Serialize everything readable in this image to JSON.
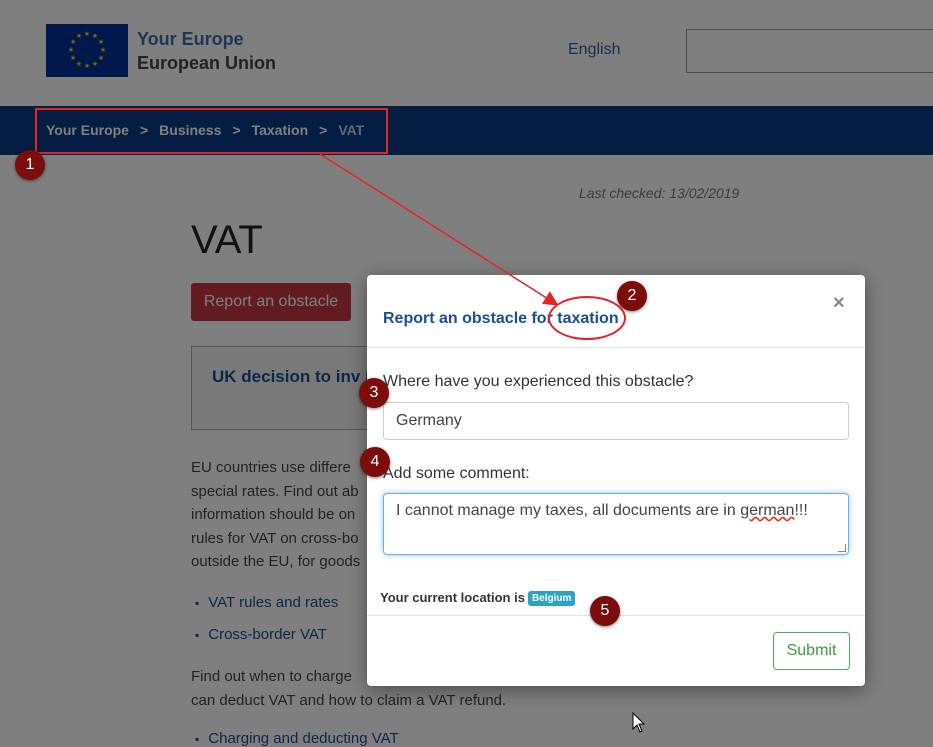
{
  "header": {
    "brand_title": "Your Europe",
    "brand_sub": "European Union",
    "language": "English",
    "search_value": ""
  },
  "breadcrumb": [
    "Your Europe",
    "Business",
    "Taxation",
    "VAT"
  ],
  "breadcrumb_separator": ">",
  "main": {
    "last_checked": "Last checked: 13/02/2019",
    "title": "VAT",
    "report_button": "Report an obstacle",
    "uk_box": "UK decision to inv information",
    "para1": [
      "EU countries use differe",
      "special rates. Find out ab",
      "information should be on",
      "rules for VAT on cross-bo",
      "outside the EU, for goods"
    ],
    "links1": [
      "VAT rules and rates",
      "Cross-border VAT"
    ],
    "para2": [
      "Find out when to charge",
      "can deduct VAT and how to claim a VAT refund."
    ],
    "links2": [
      "Charging and deducting VAT"
    ]
  },
  "modal": {
    "title_prefix": "Report an obstacle for ",
    "title_topic": "taxation",
    "close": "×",
    "q1": "Where have you experienced this obstacle?",
    "country_value": "Germany",
    "q2": "Add some comment:",
    "comment_before": "I cannot manage my taxes, all documents are in ",
    "comment_misspelled": "german",
    "comment_after": "!!!",
    "location_label": "Your current location is",
    "location_value": "Belgium",
    "submit": "Submit"
  },
  "annotations": [
    "1",
    "2",
    "3",
    "4",
    "5"
  ],
  "colors": {
    "eu_blue": "#003399",
    "breadcrumb_bar": "#0b3a86",
    "report_button": "#c43842",
    "annotation_red": "#e32424",
    "marker_fill": "#7d0d0d",
    "badge": "#2aa3c2",
    "submit_green": "#3c9b3c"
  }
}
